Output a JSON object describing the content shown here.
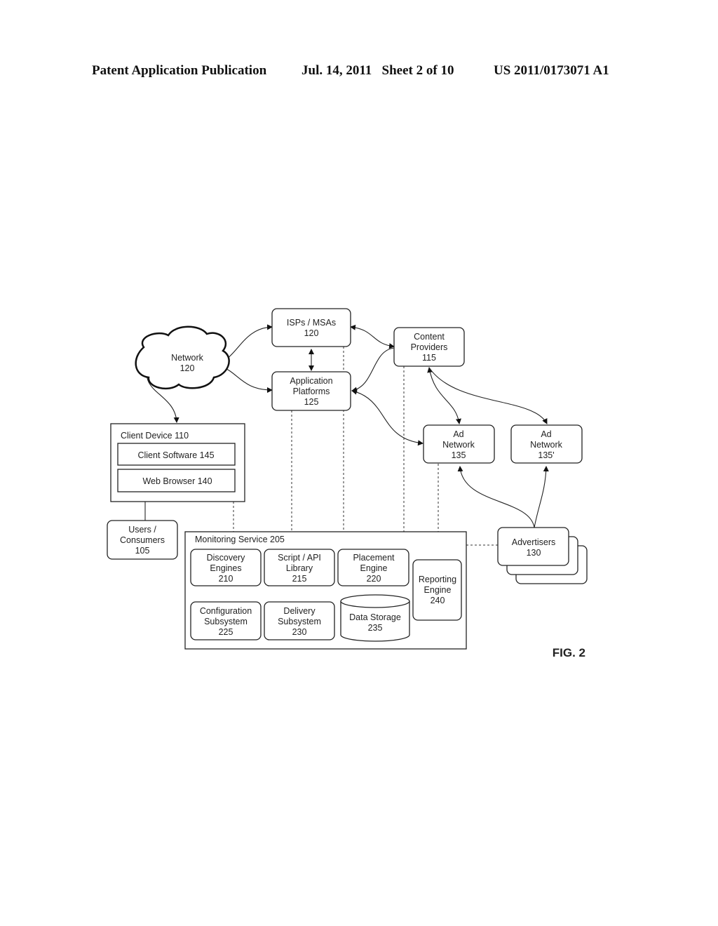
{
  "header": {
    "publication": "Patent Application Publication",
    "date_sheet": "Jul. 14, 2011   Sheet 2 of 10",
    "number": "US 2011/0173071 A1"
  },
  "figure_label": "FIG. 2",
  "nodes": {
    "network": [
      "Network",
      "120"
    ],
    "isps": [
      "ISPs / MSAs",
      "120"
    ],
    "app_platforms": [
      "Application",
      "Platforms",
      "125"
    ],
    "content_providers": [
      "Content",
      "Providers",
      "115"
    ],
    "ad_network_1": [
      "Ad",
      "Network",
      "135"
    ],
    "ad_network_2": [
      "Ad",
      "Network",
      "135'"
    ],
    "client_device": "Client Device 110",
    "client_software": "Client Software 145",
    "web_browser": "Web Browser 140",
    "users": [
      "Users /",
      "Consumers",
      "105"
    ],
    "monitoring_service": "Monitoring Service 205",
    "discovery": [
      "Discovery",
      "Engines",
      "210"
    ],
    "script_api": [
      "Script / API",
      "Library",
      "215"
    ],
    "placement": [
      "Placement",
      "Engine",
      "220"
    ],
    "reporting": [
      "Reporting",
      "Engine",
      "240"
    ],
    "configuration": [
      "Configuration",
      "Subsystem",
      "225"
    ],
    "delivery": [
      "Delivery",
      "Subsystem",
      "230"
    ],
    "data_storage": [
      "Data Storage",
      "235"
    ],
    "advertisers": [
      "Advertisers",
      "130"
    ]
  }
}
